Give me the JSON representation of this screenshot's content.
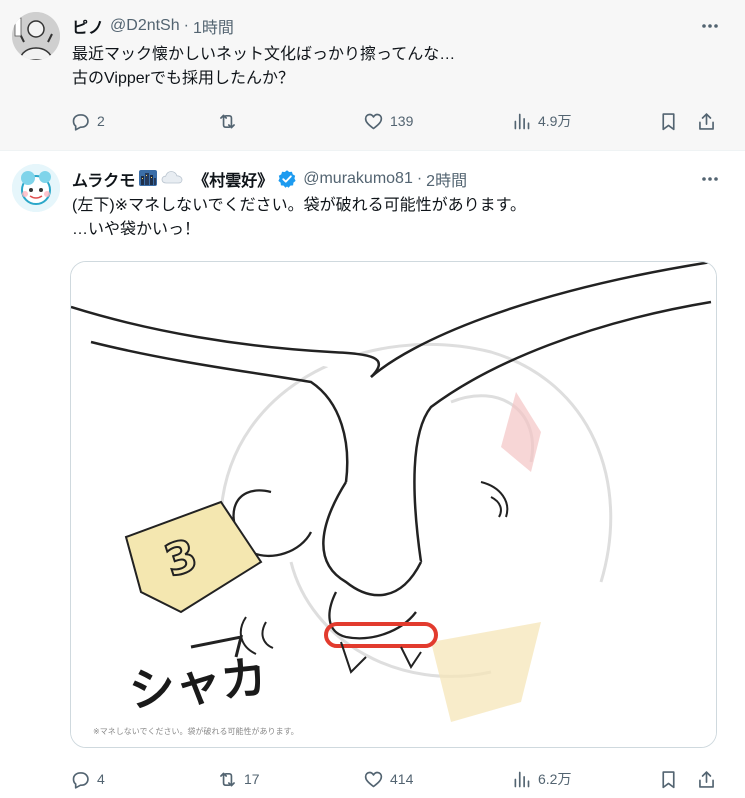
{
  "posts": [
    {
      "name": "ピノ",
      "handle": "@D2ntSh",
      "separator": "·",
      "time": "1時間",
      "text_lines": [
        "最近マック懐かしいネット文化ばっかり擦ってんな…",
        "古のVipperでも採用したんか？"
      ],
      "stats": {
        "replies": "2",
        "reposts": "",
        "likes": "139",
        "views": "4.9万"
      }
    },
    {
      "name": "ムラクモ",
      "name_suffix": "《村雲好》",
      "emojis": [
        "cityscape-icon",
        "cloud-icon"
      ],
      "verified": true,
      "handle": "@murakumo81",
      "separator": "·",
      "time": "2時間",
      "text_lines": [
        "(左下)※マネしないでください。袋が破れる可能性があります。",
        "…いや袋かいっ！"
      ],
      "media": {
        "description_icon": "illustration-image",
        "sound_effect": "シャカ",
        "caption": "※マネしないでください。袋が破れる可能性があります。",
        "packet_number": "3"
      },
      "stats": {
        "replies": "4",
        "reposts": "17",
        "likes": "414",
        "views": "6.2万"
      }
    }
  ],
  "colors": {
    "text": "#0f1419",
    "muted": "#536471",
    "verified": "#1d9bf0",
    "first_post_bg": "#f7f7f7",
    "border": "#cfd9de"
  }
}
